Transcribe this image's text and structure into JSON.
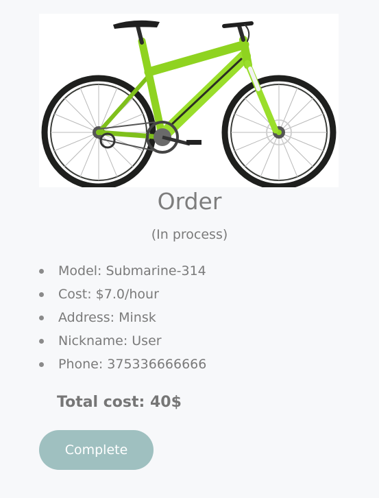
{
  "order": {
    "title": "Order",
    "status": "(In process)",
    "details": [
      "Model: Submarine-314",
      "Cost: $7.0/hour",
      "Address: Minsk",
      "Nickname: User",
      "Phone: 375336666666"
    ],
    "total_cost": "Total cost: 40$",
    "complete_label": "Complete"
  },
  "colors": {
    "background": "#f7f8fa",
    "text": "#7b7b7b",
    "button": "#9fc0c0",
    "bike_green": "#8fd320"
  },
  "image": {
    "subject": "green-mountain-bike"
  }
}
